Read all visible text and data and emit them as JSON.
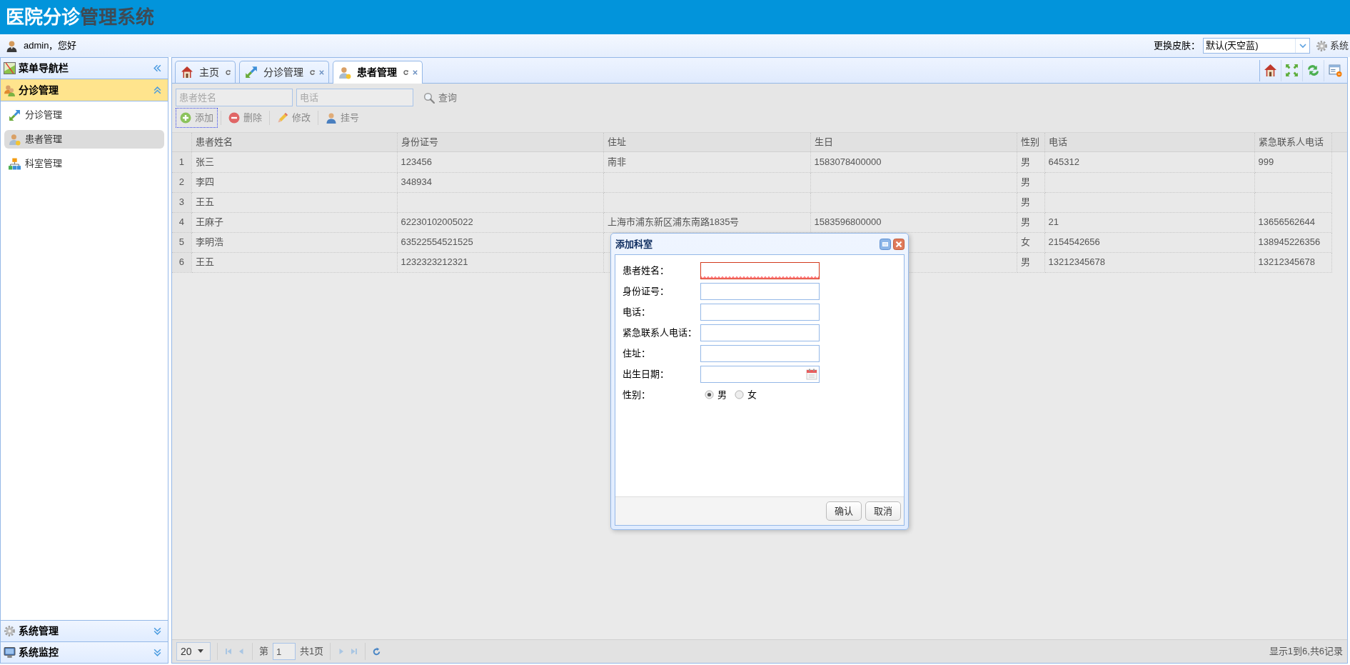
{
  "header": {
    "title": [
      {
        "text": "医院分诊",
        "color": "#ffffff"
      },
      {
        "text": "管理系统",
        "color": "#3f4a54"
      }
    ]
  },
  "user_bar": {
    "greeting": "admin，您好",
    "skin_label": "更换皮肤：",
    "skin_select": {
      "value": "默认(天空蓝)"
    },
    "system_menu": "系统"
  },
  "sidebar": {
    "title": "菜单导航栏",
    "panels": [
      {
        "title": "分诊管理",
        "expanded": true,
        "items": [
          {
            "label": "分诊管理",
            "selected": false
          },
          {
            "label": "患者管理",
            "selected": true
          },
          {
            "label": "科室管理",
            "selected": false
          }
        ]
      },
      {
        "title": "系统管理",
        "expanded": false
      },
      {
        "title": "系统监控",
        "expanded": false
      }
    ]
  },
  "tabs": [
    {
      "label": "主页",
      "closable": false,
      "selected": false
    },
    {
      "label": "分诊管理",
      "closable": true,
      "selected": false
    },
    {
      "label": "患者管理",
      "closable": true,
      "selected": true
    }
  ],
  "search": {
    "fields": [
      {
        "placeholder": "患者姓名"
      },
      {
        "placeholder": "电话"
      }
    ],
    "button": "查询"
  },
  "toolbar": [
    {
      "label": "添加",
      "focused": true
    },
    {
      "label": "删除",
      "focused": false
    },
    {
      "label": "修改",
      "focused": false
    },
    {
      "label": "挂号",
      "focused": false
    }
  ],
  "table": {
    "columns": [
      "患者姓名",
      "身份证号",
      "住址",
      "生日",
      "性别",
      "电话",
      "紧急联系人电话"
    ],
    "rows": [
      {
        "number": "1",
        "cells": [
          "张三",
          "123456",
          "南非",
          "1583078400000",
          "男",
          "645312",
          "999"
        ]
      },
      {
        "number": "2",
        "cells": [
          "李四",
          "348934",
          null,
          null,
          "男",
          null,
          null
        ]
      },
      {
        "number": "3",
        "cells": [
          "王五",
          null,
          null,
          null,
          "男",
          null,
          null
        ]
      },
      {
        "number": "4",
        "cells": [
          "王麻子",
          "62230102005022",
          "上海市浦东新区浦东南路1835号",
          "1583596800000",
          "男",
          "21",
          "13656562644"
        ]
      },
      {
        "number": "5",
        "cells": [
          "李明浩",
          "63522554521525",
          null,
          null,
          "女",
          "2154542656",
          "138945226356"
        ]
      },
      {
        "number": "6",
        "cells": [
          "王五",
          "1232323212321",
          null,
          null,
          "男",
          "13212345678",
          "13212345678"
        ]
      }
    ]
  },
  "pager": {
    "page_size": "20",
    "navigation_disabled": true,
    "page_prefix": "第",
    "page": "1",
    "page_total": "共1页",
    "summary": "显示1到6,共6记录"
  },
  "dialog": {
    "title": "添加科室",
    "fields": [
      {
        "kind": "text",
        "label": "患者姓名：",
        "invalid": true
      },
      {
        "kind": "text",
        "label": "身份证号：",
        "invalid": false
      },
      {
        "kind": "text",
        "label": "电话：",
        "invalid": false
      },
      {
        "kind": "text",
        "label": "紧急联系人电话：",
        "invalid": false
      },
      {
        "kind": "text",
        "label": "住址：",
        "invalid": false
      },
      {
        "kind": "date",
        "label": "出生日期：",
        "invalid": false
      },
      {
        "kind": "radio",
        "label": "性别：",
        "options": [
          {
            "label": "男",
            "selected": true
          },
          {
            "label": "女",
            "selected": false
          }
        ]
      }
    ],
    "buttons": [
      "确认",
      "取消"
    ]
  }
}
